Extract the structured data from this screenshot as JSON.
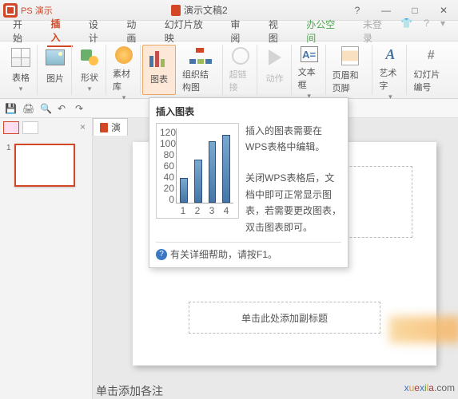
{
  "titlebar": {
    "app_name": "PS 演示",
    "doc_title": "演示文稿2"
  },
  "menu": {
    "items": [
      "开始",
      "插入",
      "设计",
      "动画",
      "幻灯片放映",
      "审阅",
      "视图"
    ],
    "office_space": "办公空间",
    "not_logged": "未登录"
  },
  "ribbon": {
    "table": "表格",
    "picture": "图片",
    "shape": "形状",
    "library": "素材库",
    "chart": "图表",
    "org": "组织结构图",
    "hyperlink": "超链接",
    "action": "动作",
    "textbox": "文本框",
    "header_footer": "页眉和页脚",
    "wordart": "艺术字",
    "slide_no": "幻灯片编号",
    "textbox_glyph": "A=",
    "wordart_glyph": "A",
    "slnum_glyph": "#"
  },
  "doctab": {
    "label": "演"
  },
  "thumb": {
    "num": "1"
  },
  "slide": {
    "subtitle_placeholder": "单击此处添加副标题"
  },
  "notes": {
    "placeholder": "单击添加各注"
  },
  "tooltip": {
    "title": "插入图表",
    "desc1": "插入的图表需要在WPS表格中编辑。",
    "desc2": "关闭WPS表格后，文档中即可正常显示图表，若需要更改图表，双击图表即可。",
    "footer": "有关详细帮助，请按F1。",
    "help_glyph": "?"
  },
  "chart_data": {
    "type": "bar",
    "categories": [
      "1",
      "2",
      "3",
      "4"
    ],
    "values": [
      40,
      70,
      100,
      110
    ],
    "y_ticks": [
      "120",
      "100",
      "80",
      "60",
      "40",
      "20",
      "0"
    ],
    "ylim": [
      0,
      120
    ]
  },
  "watermark": {
    "host": "xuexila",
    "tld": ".com"
  }
}
